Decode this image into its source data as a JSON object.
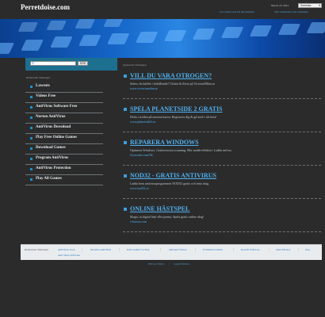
{
  "header": {
    "site_title": "Perretdoise.com",
    "date": "March 23, 2012",
    "language": "Svenska",
    "links": [
      "Gör denna sida till din hemsida",
      "Sätt webbsidan som bokmärke"
    ]
  },
  "search": {
    "placeholder": "",
    "button_label": "SÖK"
  },
  "sidebar": {
    "heading": "Relaterade Sökningar",
    "items": [
      {
        "label": "Lawsuts"
      },
      {
        "label": "Videos Free"
      },
      {
        "label": "AntiVirus Software Free"
      },
      {
        "label": "Norton AntiVirus"
      },
      {
        "label": "AntiVirus Download"
      },
      {
        "label": "Play Free Online Games"
      },
      {
        "label": "Download Games"
      },
      {
        "label": "Program AntiVirus"
      },
      {
        "label": "AntiVirus Protection"
      },
      {
        "label": "Play All Games"
      }
    ]
  },
  "main": {
    "heading": "Sponsrade Sökningar",
    "ads": [
      {
        "title": "VILL DU VARA OTROGEN?",
        "desc": "Sidesc du kärlek i förhållande? Chatta & flörta på VictoriaMilan.se",
        "url": "www.victoriamilan.se"
      },
      {
        "title": "SPELA PLANETSIDE 2 GRATIS",
        "desc": "Delta i striden på enorma kartor. Registrera dig & gå med i vår beta!",
        "url": "www.planetside2.eu"
      },
      {
        "title": "REPARERA WINDOWS",
        "desc": "Optimera Windows. Gratisversion scanning. Mer snabb-effektivt. Ladda ned nu.",
        "url": "Systweak.com/NL"
      },
      {
        "title": "NOD32 - GRATIS ANTIVIRUS",
        "desc": "Ladda hem antivirusprogrammet NOD32 gratis och testa idag.",
        "url": "www.nod32.se"
      },
      {
        "title": "ONLINE HÄSTSPEL",
        "desc": "Skapa, ta digital häst eller ponny. Spela gratis online idag!",
        "url": "e-horses.com"
      }
    ]
  },
  "footer": {
    "heading": "Relaterade Sökningar",
    "links": [
      "AntiVirus Scan",
      "McAfee AntiVirus",
      "Kids Games To Play",
      "Amateur Videos",
      "Formulate Games",
      "Kostfri Software",
      "Sites Movies",
      "Avg",
      "Anti Virus Software"
    ],
    "bottom_links": [
      "Privacy Policy",
      "Legal Policies"
    ]
  }
}
